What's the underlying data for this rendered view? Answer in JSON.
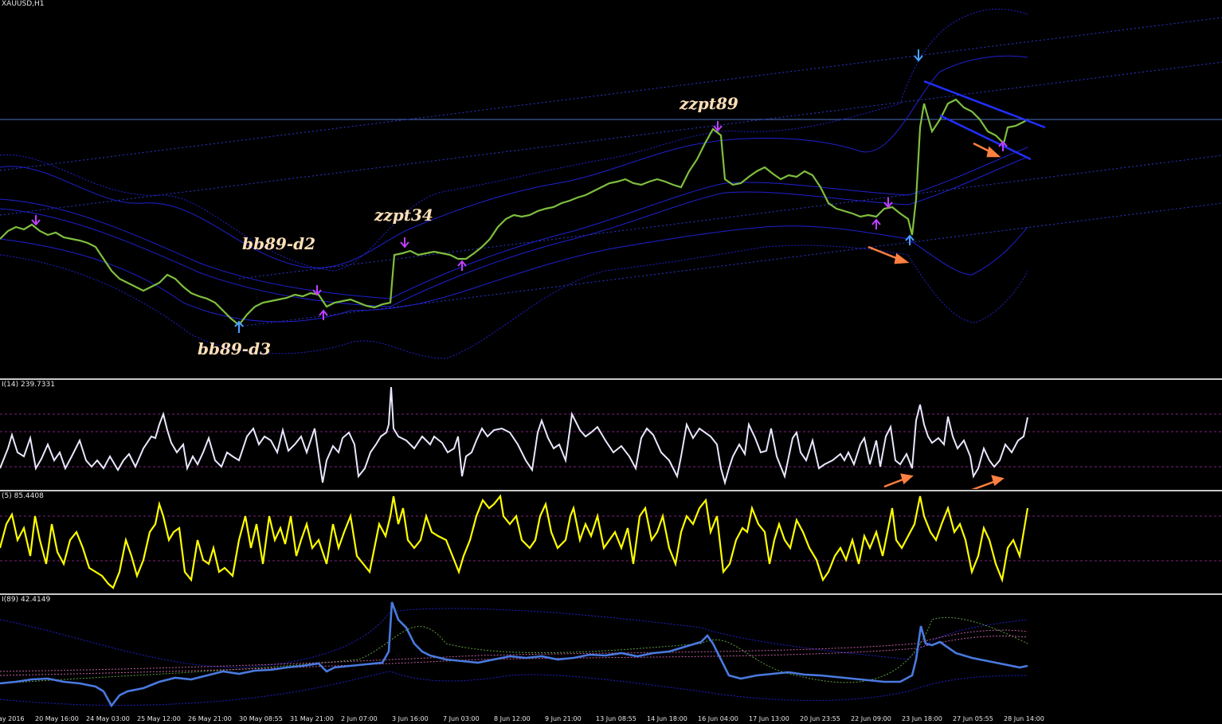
{
  "symbol_label": "XAUUSD,H1",
  "annotations": {
    "zzpt89": "zzpt89",
    "zzpt34": "zzpt34",
    "bb89_d2": "bb89-d2",
    "bb89_d3": "bb89-d3"
  },
  "indicator_labels": {
    "pane1": "I(14) 239.7331",
    "pane2": "(5) 85.4408",
    "pane3": "I(89) 42.4149"
  },
  "time_axis": [
    "ay 2016",
    "20 May 16:00",
    "24 May 03:00",
    "25 May 12:00",
    "26 May 21:00",
    "30 May 08:55",
    "31 May 21:00",
    "2 Jun 07:00",
    "3 Jun 16:00",
    "7 Jun 03:00",
    "8 Jun 12:00",
    "9 Jun 21:00",
    "13 Jun 08:55",
    "14 Jun 18:00",
    "16 Jun 04:00",
    "17 Jun 13:00",
    "20 Jun 23:55",
    "22 Jun 09:00",
    "23 Jun 18:00",
    "27 Jun 05:55",
    "28 Jun 14:00"
  ],
  "colors": {
    "candles": "#7fbf3f",
    "bands": "#2020d0",
    "arrow_up": "#4aa0ff",
    "arrow_marker": "#c040ff",
    "orange_arrow": "#ff8040",
    "cci_line": "#e8e8ff",
    "stoch_line": "#ffff00",
    "adx_line": "#4a7ae0"
  },
  "chart_data": [
    {
      "type": "line",
      "title": "XAUUSD,H1",
      "series": [
        {
          "values": [
            1258,
            1252,
            1250,
            1246,
            1240,
            1236,
            1232,
            1230,
            1234,
            1236,
            1238,
            1242,
            1244,
            1240,
            1246,
            1258,
            1262,
            1262,
            1268,
            1270,
            1274,
            1272,
            1276,
            1280,
            1282,
            1284,
            1290,
            1296,
            1284,
            1286,
            1288,
            1284,
            1278,
            1276,
            1274,
            1270,
            1266,
            1268,
            1300,
            1312,
            1304,
            1300,
            1296,
            1298,
            1300
          ]
        }
      ]
    }
  ]
}
